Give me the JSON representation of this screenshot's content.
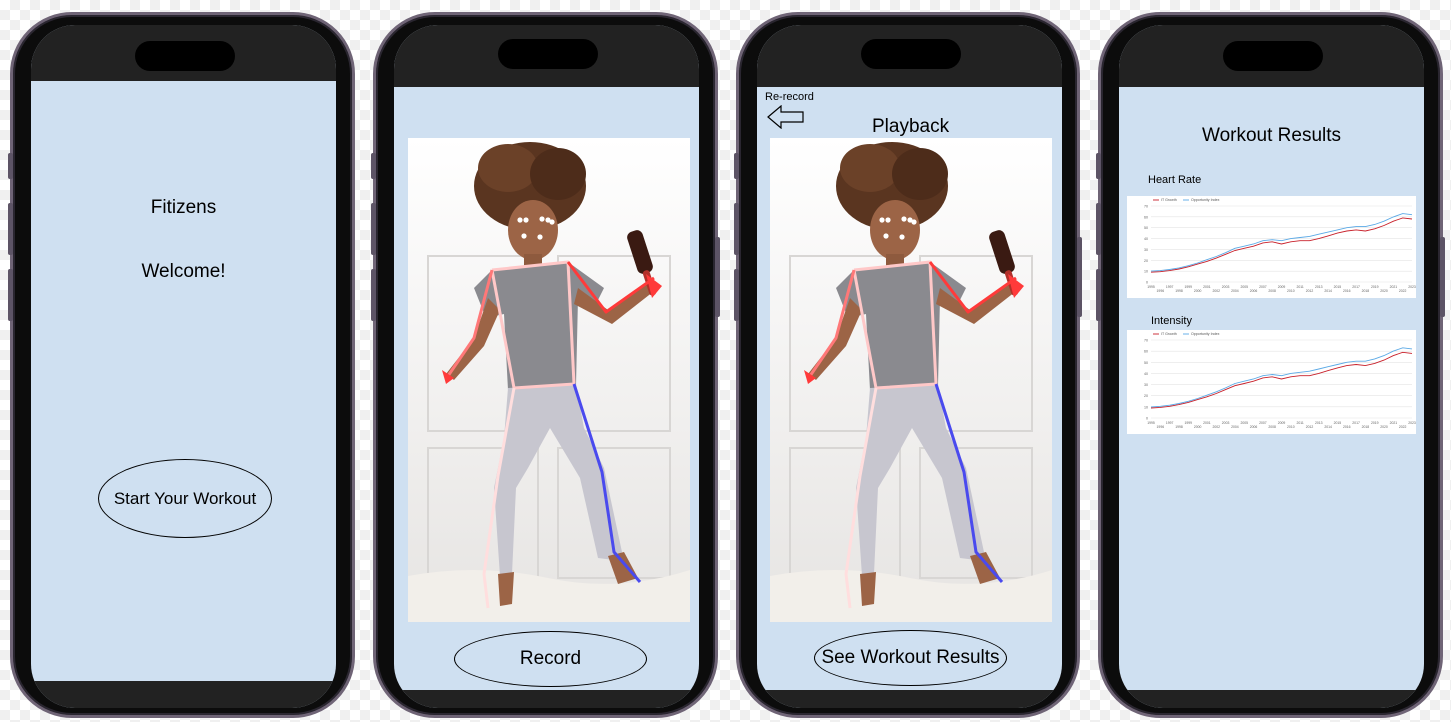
{
  "colors": {
    "screen_bg": "#cfe0f1",
    "bezel": "#222222",
    "skeleton_left": "#ff3a3a",
    "skeleton_right": "#4a4aee",
    "series_1": "#c8202a",
    "series_2": "#5aa9e6"
  },
  "screen1": {
    "app_name": "Fitizens",
    "welcome": "Welcome!",
    "start_button": "Start Your Workout"
  },
  "screen2": {
    "record_button": "Record"
  },
  "screen3": {
    "back_label": "Re-record",
    "back_icon": "left-arrow-icon",
    "title": "Playback",
    "results_button": "See Workout Results"
  },
  "screen4": {
    "title": "Workout Results",
    "chart1_label": "Heart Rate",
    "chart2_label": "Intensity"
  },
  "chart_data": [
    {
      "type": "line",
      "title": "Heart Rate",
      "x": [
        "1995",
        "1996",
        "1997",
        "1998",
        "1999",
        "2000",
        "2001",
        "2002",
        "2003",
        "2004",
        "2005",
        "2006",
        "2007",
        "2008",
        "2009",
        "2010",
        "2011",
        "2012",
        "2013",
        "2014",
        "2015",
        "2016",
        "2017",
        "2018",
        "2019",
        "2020",
        "2021",
        "2022",
        "2023"
      ],
      "series": [
        {
          "name": "IT Growth",
          "values": [
            9,
            9.5,
            10.5,
            12,
            14,
            16.5,
            19,
            22,
            25.5,
            29,
            31,
            33,
            36,
            37,
            35,
            37,
            38,
            38,
            40,
            42.5,
            45,
            47,
            48,
            47,
            49,
            52,
            56,
            59,
            58
          ]
        },
        {
          "name": "Opportunity Index",
          "values": [
            10,
            10.5,
            11.5,
            13,
            15,
            17.5,
            20.5,
            23.5,
            27,
            31,
            33,
            35,
            38,
            39,
            38,
            40,
            41,
            42,
            44,
            46,
            48,
            50,
            51,
            51,
            53,
            56,
            60,
            63,
            62
          ]
        }
      ],
      "ylim": [
        0,
        70
      ],
      "legend": "top-left"
    },
    {
      "type": "line",
      "title": "Intensity",
      "x": [
        "1995",
        "1996",
        "1997",
        "1998",
        "1999",
        "2000",
        "2001",
        "2002",
        "2003",
        "2004",
        "2005",
        "2006",
        "2007",
        "2008",
        "2009",
        "2010",
        "2011",
        "2012",
        "2013",
        "2014",
        "2015",
        "2016",
        "2017",
        "2018",
        "2019",
        "2020",
        "2021",
        "2022",
        "2023"
      ],
      "series": [
        {
          "name": "IT Growth",
          "values": [
            9,
            9.5,
            10.5,
            12,
            14,
            16.5,
            19,
            22,
            25.5,
            29,
            31,
            33,
            36,
            37,
            35,
            37,
            38,
            38,
            40,
            42.5,
            45,
            47,
            48,
            47,
            49,
            52,
            56,
            59,
            58
          ]
        },
        {
          "name": "Opportunity Index",
          "values": [
            10,
            10.5,
            11.5,
            13,
            15,
            17.5,
            20.5,
            23.5,
            27,
            31,
            33,
            35,
            38,
            39,
            38,
            40,
            41,
            42,
            44,
            46,
            48,
            50,
            51,
            51,
            53,
            56,
            60,
            63,
            62
          ]
        }
      ],
      "ylim": [
        0,
        70
      ],
      "legend": "top-left"
    }
  ]
}
